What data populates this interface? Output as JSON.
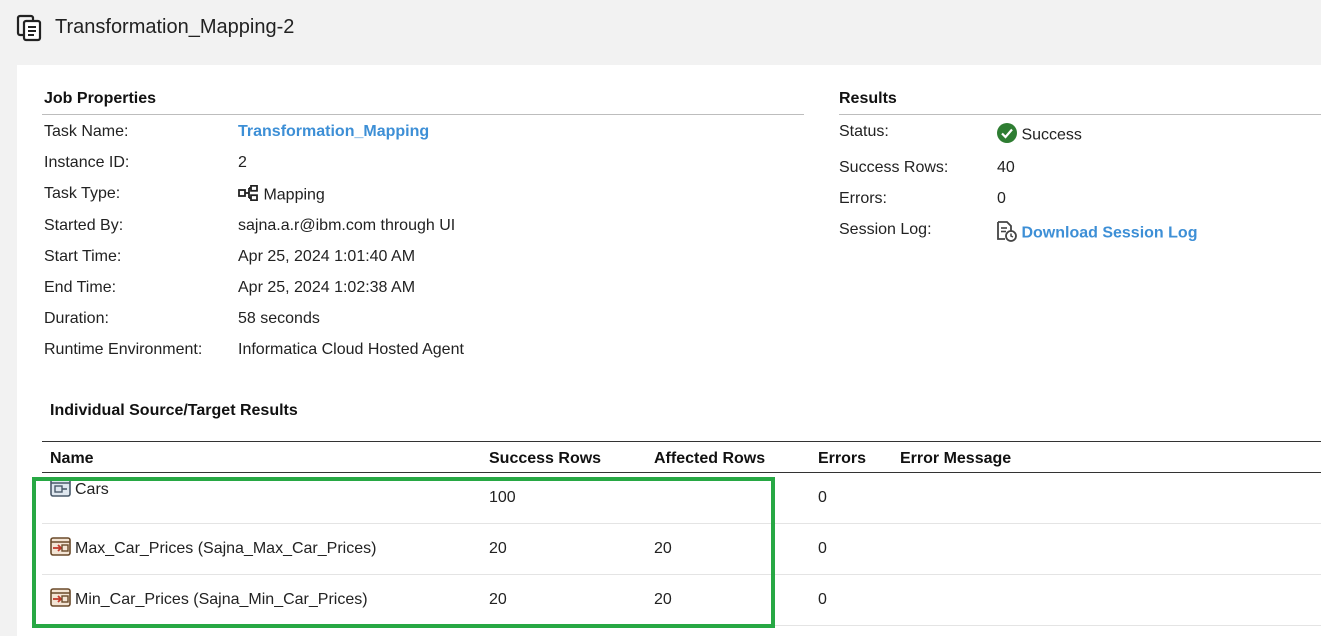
{
  "header": {
    "title": "Transformation_Mapping-2",
    "icon": "copy-document-icon"
  },
  "job_properties": {
    "heading": "Job Properties",
    "rows": [
      {
        "label": "Task Name:",
        "value": "Transformation_Mapping"
      },
      {
        "label": "Instance ID:",
        "value": "2"
      },
      {
        "label": "Task Type:",
        "value": "Mapping"
      },
      {
        "label": "Started By:",
        "value": "sajna.a.r@ibm.com through UI"
      },
      {
        "label": "Start Time:",
        "value": "Apr 25, 2024 1:01:40 AM"
      },
      {
        "label": "End Time:",
        "value": "Apr 25, 2024 1:02:38 AM"
      },
      {
        "label": "Duration:",
        "value": "58 seconds"
      },
      {
        "label": "Runtime Environment:",
        "value": "Informatica Cloud Hosted Agent"
      }
    ]
  },
  "results": {
    "heading": "Results",
    "status_label": "Status:",
    "status_value": "Success",
    "success_rows_label": "Success Rows:",
    "success_rows_value": "40",
    "errors_label": "Errors:",
    "errors_value": "0",
    "session_log_label": "Session Log:",
    "session_log_link": "Download Session Log"
  },
  "individual": {
    "heading": "Individual Source/Target Results",
    "columns": [
      "Name",
      "Success Rows",
      "Affected Rows",
      "Errors",
      "Error Message"
    ],
    "rows": [
      {
        "name": "Cars",
        "success_rows": "100",
        "affected_rows": "",
        "errors": "0",
        "error_message": "",
        "icon": "source-icon"
      },
      {
        "name": "Max_Car_Prices (Sajna_Max_Car_Prices)",
        "success_rows": "20",
        "affected_rows": "20",
        "errors": "0",
        "error_message": "",
        "icon": "target-icon"
      },
      {
        "name": "Min_Car_Prices (Sajna_Min_Car_Prices)",
        "success_rows": "20",
        "affected_rows": "20",
        "errors": "0",
        "error_message": "",
        "icon": "target-icon"
      }
    ]
  },
  "colors": {
    "link": "#3d8fd6",
    "success_green": "#2e7d32",
    "highlight_green": "#27a844"
  }
}
